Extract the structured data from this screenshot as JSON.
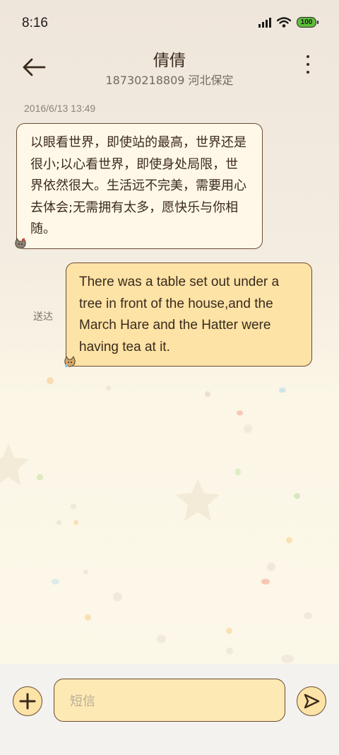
{
  "status_bar": {
    "time": "8:16",
    "battery": "100",
    "icons": [
      "signal-icon",
      "wifi-icon",
      "battery-icon"
    ]
  },
  "header": {
    "title": "倩倩",
    "subtitle": "18730218809 河北保定"
  },
  "conversation": {
    "timestamp": "2016/6/13 13:49",
    "messages": [
      {
        "direction": "incoming",
        "text": "以眼看世界，即使站的最高，世界还是很小;以心看世界，即使身处局限，世界依然很大。生活远不完美，需要用心去体会;无需拥有太多，愿快乐与你相随。"
      },
      {
        "direction": "outgoing",
        "text": "There was a table set out under a tree in front of the house,and the March Hare and the Hatter were having tea at it.",
        "status": "送达"
      }
    ]
  },
  "composer": {
    "placeholder": "短信"
  },
  "colors": {
    "incoming_bubble": "#fff8e8",
    "outgoing_bubble": "#fde3a6",
    "bubble_border": "#6b4b33",
    "input_bg": "#fde9b3"
  }
}
